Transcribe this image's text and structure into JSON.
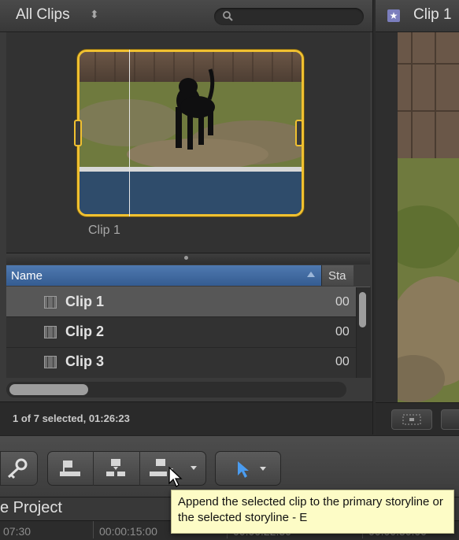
{
  "browser": {
    "library_title": "All Clips",
    "library_arrows": "⬍",
    "search": {
      "placeholder": ""
    },
    "thumbnail": {
      "label": "Clip 1"
    },
    "list": {
      "columns": [
        "Name",
        "Sta"
      ],
      "rows": [
        {
          "name": "Clip 1",
          "start": "00"
        },
        {
          "name": "Clip 2",
          "start": "00"
        },
        {
          "name": "Clip 3",
          "start": "00"
        }
      ]
    },
    "status": "1 of 7 selected, 01:26:23"
  },
  "viewer": {
    "title": "Clip 1",
    "icon": "star-icon"
  },
  "toolbar": {
    "buttons": [
      "key-icon",
      "connect-clip-icon",
      "insert-clip-icon",
      "append-clip-icon",
      "edit-options-chevron-icon",
      "select-tool-arrow-icon",
      "tool-chevron-icon"
    ]
  },
  "project": {
    "title": "e Project",
    "timecodes": [
      "07:30",
      "00:00:15:00",
      "00:00:22:30",
      "00:00:30:00"
    ]
  },
  "tooltip": {
    "text": "Append the selected clip to the primary storyline or the selected storyline - E"
  },
  "colors": {
    "selection_border": "#f0c030",
    "list_header": "#4a73aa",
    "tooltip_bg": "#fdfcc6"
  }
}
